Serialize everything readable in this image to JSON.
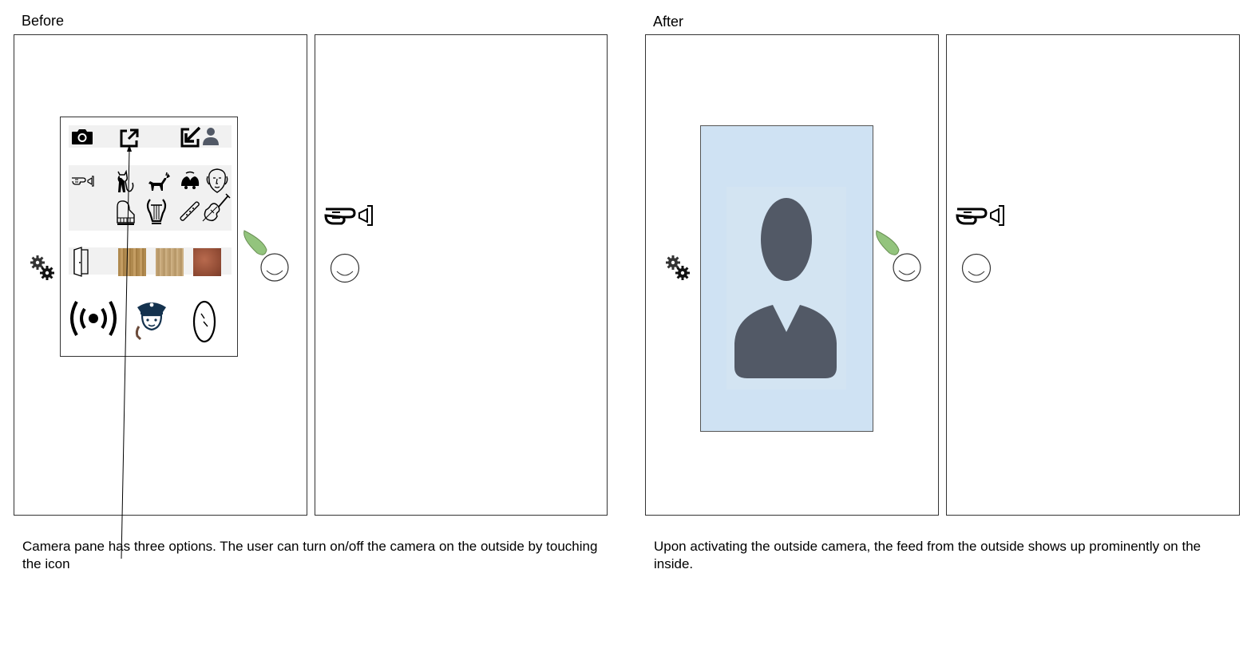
{
  "before": {
    "title": "Before",
    "caption": "Camera pane has three options. The user can turn on/off the camera on the outside by touching the icon"
  },
  "after": {
    "title": "After",
    "caption": "Upon activating the outside camera, the feed from the outside shows up prominently on the inside."
  },
  "colors": {
    "feed_background": "#cfe2f3",
    "silhouette": "#525966",
    "knob_leaf": "#93c47d",
    "panel_border": "#333333"
  },
  "icons": {
    "camera_row": [
      "camera-icon",
      "share-out-icon",
      "share-in-icon",
      "user-icon"
    ],
    "sound_grid": [
      "pointing-hand-bell-icon",
      "cat-icon",
      "dog-icon",
      "bells-icon",
      "face-icon",
      "piano-icon",
      "lyre-icon",
      "flute-icon",
      "violin-icon"
    ],
    "door_row": [
      "door-icon",
      "wood-texture-light",
      "wood-texture-pale",
      "wood-texture-red"
    ],
    "bottom_row": [
      "broadcast-icon",
      "police-call-icon",
      "oval-mirror-icon"
    ]
  }
}
